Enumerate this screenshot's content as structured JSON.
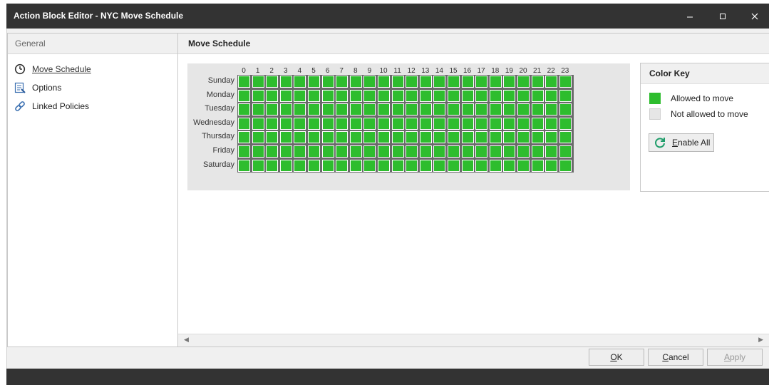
{
  "window": {
    "title": "Action Block Editor - NYC Move Schedule"
  },
  "left_panel": {
    "header": "General",
    "items": [
      {
        "label": "Move Schedule",
        "icon": "clock-icon",
        "active": true
      },
      {
        "label": "Options",
        "icon": "options-icon",
        "active": false
      },
      {
        "label": "Linked Policies",
        "icon": "link-icon",
        "active": false
      }
    ]
  },
  "main_panel": {
    "header": "Move Schedule",
    "hours": [
      "0",
      "1",
      "2",
      "3",
      "4",
      "5",
      "6",
      "7",
      "8",
      "9",
      "10",
      "11",
      "12",
      "13",
      "14",
      "15",
      "16",
      "17",
      "18",
      "19",
      "20",
      "21",
      "22",
      "23"
    ],
    "days": [
      "Sunday",
      "Monday",
      "Tuesday",
      "Wednesday",
      "Thursday",
      "Friday",
      "Saturday"
    ],
    "cell_state": "allowed",
    "colors": {
      "allowed": "#2ebd2e",
      "not_allowed": "#e6e6e6"
    }
  },
  "color_key": {
    "title": "Color Key",
    "allowed_label": "Allowed to move",
    "not_allowed_label": "Not allowed to move",
    "enable_all": {
      "prefix": "",
      "mnemonic": "E",
      "rest": "nable All"
    }
  },
  "buttons": {
    "ok": {
      "mnemonic": "O",
      "rest": "K"
    },
    "cancel": {
      "mnemonic": "C",
      "rest": "ancel"
    },
    "apply": {
      "mnemonic": "A",
      "rest": "pply",
      "enabled": false
    }
  }
}
